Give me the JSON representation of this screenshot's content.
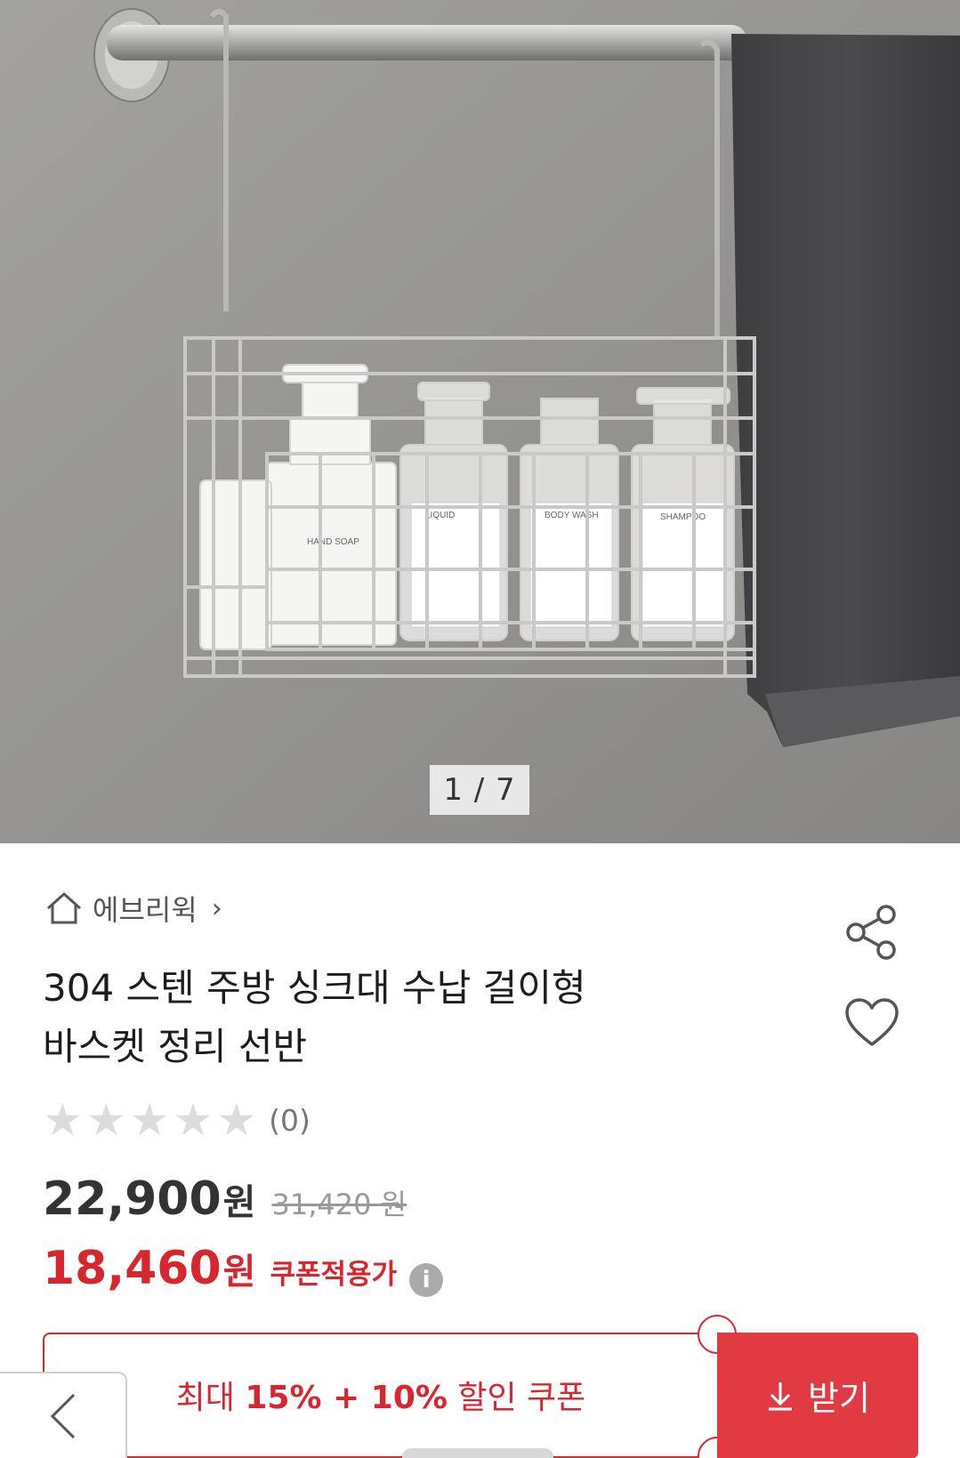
{
  "hero": {
    "counter": "1 / 7",
    "labels": {
      "hand_soap": "HAND SOAP",
      "liquid": "LIQUID",
      "body_wash": "BODY WASH",
      "shampoo": "SHAMPOO"
    }
  },
  "store": {
    "icon": "home-icon",
    "name": "에브리윅",
    "chevron": "›"
  },
  "actions": {
    "share_icon": "share-icon",
    "wish_icon": "heart-icon"
  },
  "product": {
    "title_line1": "304 스텐 주방 싱크대 수납 걸이형",
    "title_line2": "바스켓 정리 선반",
    "rating_stars": 0,
    "review_count": "(0)"
  },
  "price": {
    "sale": "22,900",
    "sale_unit": "원",
    "original": "31,420 원",
    "coupon_price": "18,460",
    "coupon_unit": "원",
    "coupon_note": "쿠폰적용가",
    "info_icon": "i"
  },
  "coupon": {
    "prefix": "최대 ",
    "pct1": "15%",
    "plus": " + ",
    "pct2": "10%",
    "suffix": " 할인 쿠폰",
    "get_label": "받기",
    "get_icon": "download-icon"
  },
  "nav": {
    "back_icon": "chevron-left-icon"
  },
  "colors": {
    "accent": "#d8262f",
    "button": "#e23a42",
    "star_empty": "#dcdcdc"
  }
}
